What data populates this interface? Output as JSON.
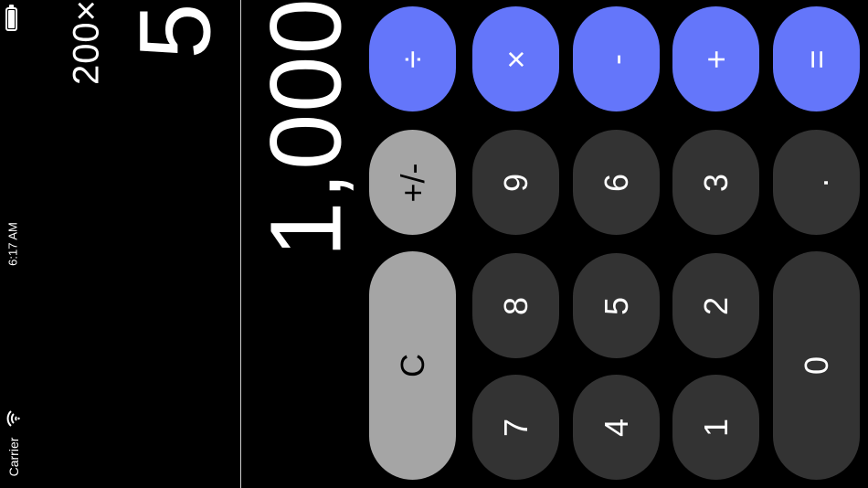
{
  "status_bar": {
    "carrier": "Carrier",
    "time": "6:17 AM",
    "battery_icon": "battery-icon",
    "wifi_icon": "wifi-icon"
  },
  "display": {
    "expression": "200×",
    "previous": "5",
    "value": "1,000"
  },
  "keypad": {
    "divide": "÷",
    "multiply": "×",
    "minus": "-",
    "plus": "+",
    "equals": "=",
    "plus_minus": "+/-",
    "clear": "C",
    "nine": "9",
    "six": "6",
    "three": "3",
    "decimal": ".",
    "eight": "8",
    "five": "5",
    "two": "2",
    "zero": "0",
    "seven": "7",
    "four": "4",
    "one": "1"
  },
  "colors": {
    "operator": "#6476fa",
    "number": "#333333",
    "function": "#a5a5a5",
    "background": "#000000"
  }
}
